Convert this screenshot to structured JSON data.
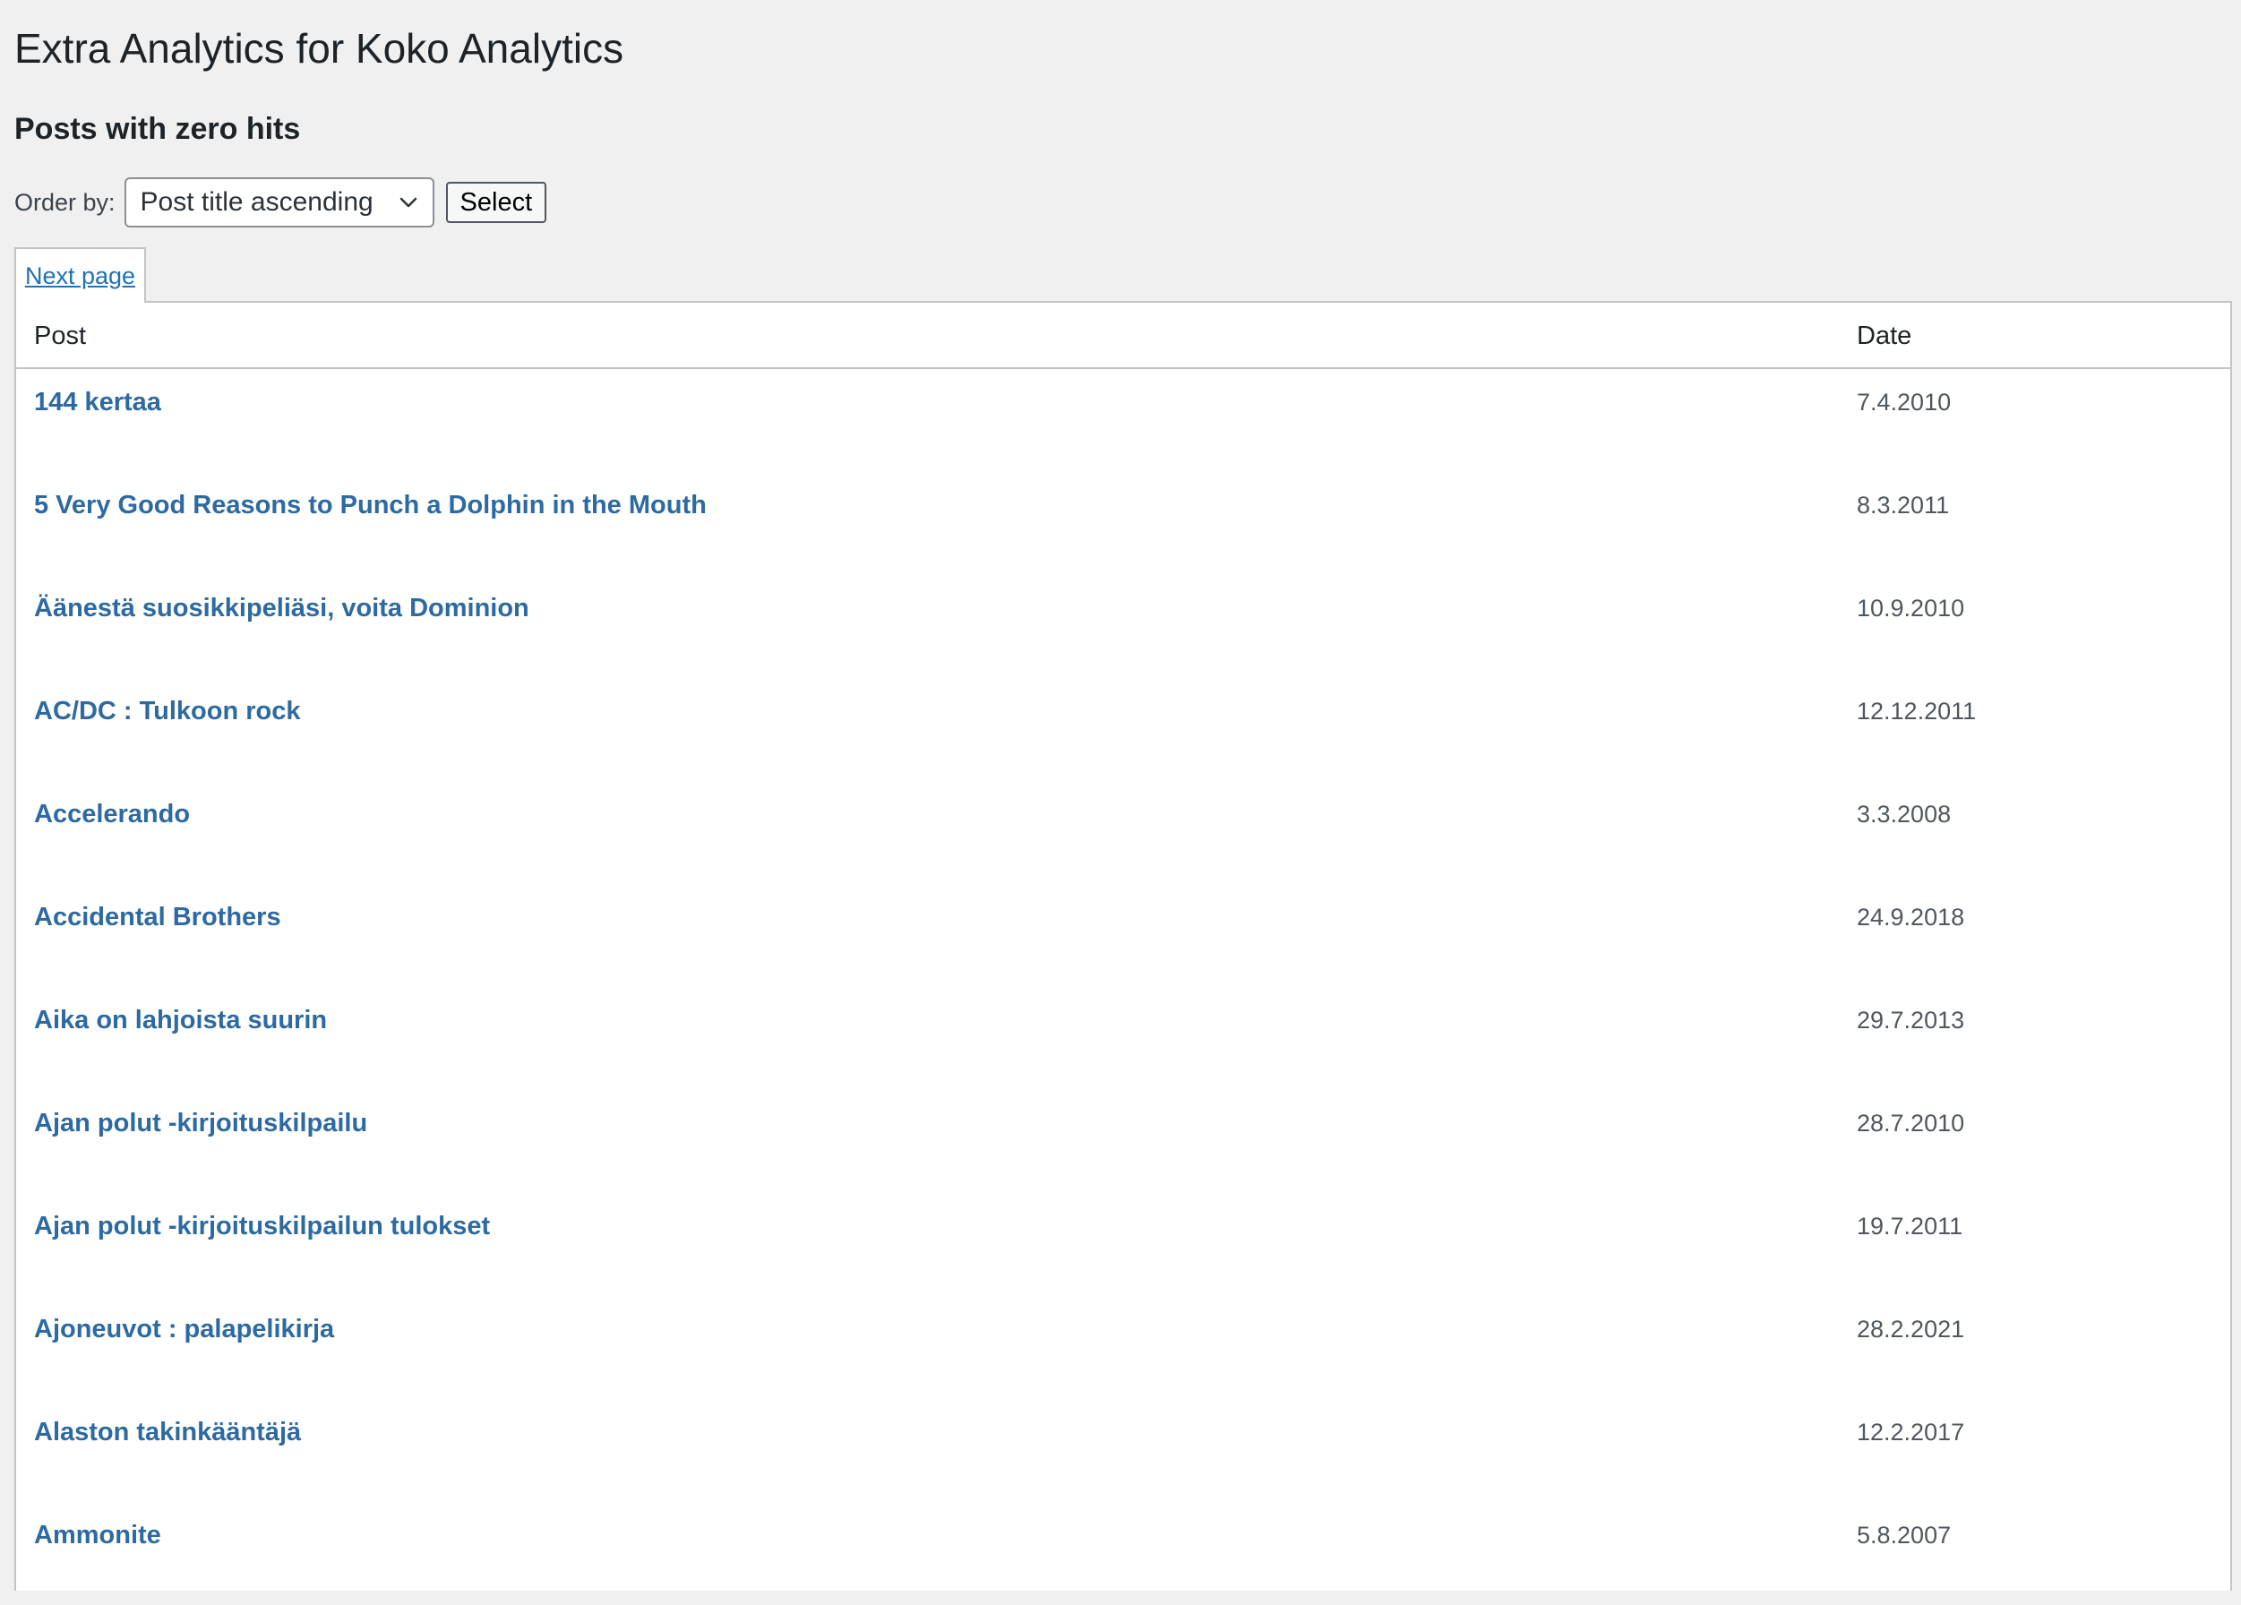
{
  "page": {
    "title": "Extra Analytics for Koko Analytics",
    "section_title": "Posts with zero hits"
  },
  "order": {
    "label": "Order by:",
    "selected": "Post title ascending",
    "button_label": "Select"
  },
  "pagination": {
    "next_label": "Next page"
  },
  "table": {
    "headers": {
      "post": "Post",
      "date": "Date"
    },
    "rows": [
      {
        "title": "144 kertaa",
        "date": "7.4.2010"
      },
      {
        "title": "5 Very Good Reasons to Punch a Dolphin in the Mouth",
        "date": "8.3.2011"
      },
      {
        "title": "Äänestä suosikkipeliäsi, voita Dominion",
        "date": "10.9.2010"
      },
      {
        "title": "AC/DC : Tulkoon rock",
        "date": "12.12.2011"
      },
      {
        "title": "Accelerando",
        "date": "3.3.2008"
      },
      {
        "title": "Accidental Brothers",
        "date": "24.9.2018"
      },
      {
        "title": "Aika on lahjoista suurin",
        "date": "29.7.2013"
      },
      {
        "title": "Ajan polut -kirjoituskilpailu",
        "date": "28.7.2010"
      },
      {
        "title": "Ajan polut -kirjoituskilpailun tulokset",
        "date": "19.7.2011"
      },
      {
        "title": "Ajoneuvot : palapelikirja",
        "date": "28.2.2021"
      },
      {
        "title": "Alaston takinkääntäjä",
        "date": "12.2.2017"
      },
      {
        "title": "Ammonite",
        "date": "5.8.2007"
      }
    ]
  },
  "colors": {
    "link": "#2d6aa1",
    "background": "#f0f0f1",
    "border": "#c3c4c7"
  }
}
